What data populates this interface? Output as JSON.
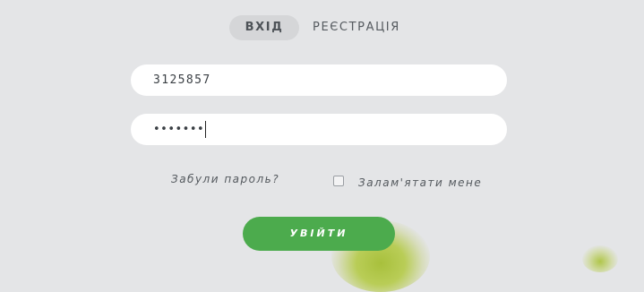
{
  "tabs": {
    "login_label": "ВХІД",
    "register_label": "РЕЄСТРАЦІЯ",
    "active": "login"
  },
  "form": {
    "login_value": "3125857",
    "password_mask": "•••••••",
    "forgot_label": "Забули пароль?",
    "remember_label": "Залам'ятати мене",
    "remember_checked": false,
    "submit_label": "УВІЙТИ"
  },
  "colors": {
    "background": "#e4e5e7",
    "field": "#ffffff",
    "active_tab": "#d5d6d8",
    "button": "#4cab4d"
  }
}
